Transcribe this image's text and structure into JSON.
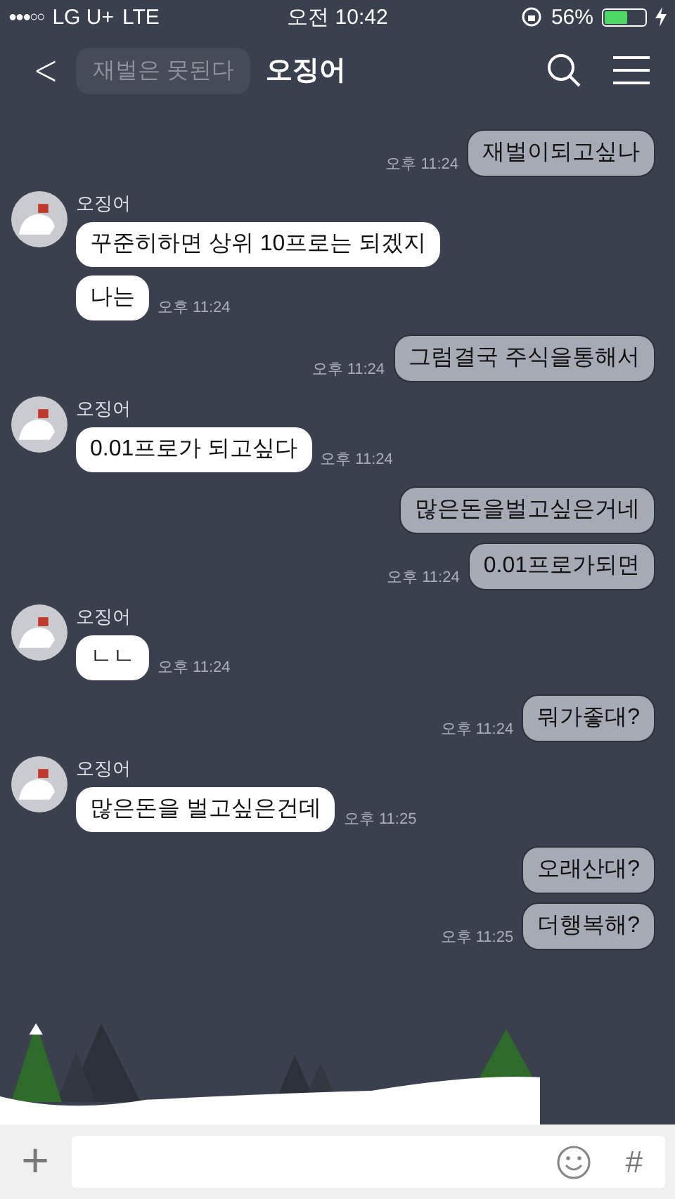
{
  "status_bar": {
    "signal": "●●●○○",
    "carrier": "LG U+",
    "network": "LTE",
    "time": "오전 10:42",
    "battery": "56%"
  },
  "header": {
    "back": "<",
    "title": "오징어",
    "ghost_message": "재벌은 못된다"
  },
  "messages": [
    {
      "kind": "out",
      "text": "재벌이되고싶나",
      "time": "오후 11:24"
    },
    {
      "kind": "in",
      "sender": "오징어",
      "text": "꾸준히하면 상위 10프로는 되겠지"
    },
    {
      "kind": "in",
      "text": "나는",
      "time": "오후 11:24"
    },
    {
      "kind": "out",
      "text": "그럼결국 주식을통해서",
      "time": "오후 11:24"
    },
    {
      "kind": "in",
      "sender": "오징어",
      "text": "0.01프로가 되고싶다",
      "time": "오후 11:24"
    },
    {
      "kind": "out",
      "text": "많은돈을벌고싶은거네"
    },
    {
      "kind": "out",
      "text": "0.01프로가되면",
      "time": "오후 11:24"
    },
    {
      "kind": "in",
      "sender": "오징어",
      "text": "ㄴㄴ",
      "time": "오후 11:24"
    },
    {
      "kind": "out",
      "text": "뭐가좋대?",
      "time": "오후 11:24"
    },
    {
      "kind": "in",
      "sender": "오징어",
      "text": "많은돈을 벌고싶은건데",
      "time": "오후 11:25"
    },
    {
      "kind": "out",
      "text": "오래산대?"
    },
    {
      "kind": "out",
      "text": "더행복해?",
      "time": "오후 11:25"
    }
  ],
  "input": {
    "plus": "+",
    "hash": "#"
  }
}
